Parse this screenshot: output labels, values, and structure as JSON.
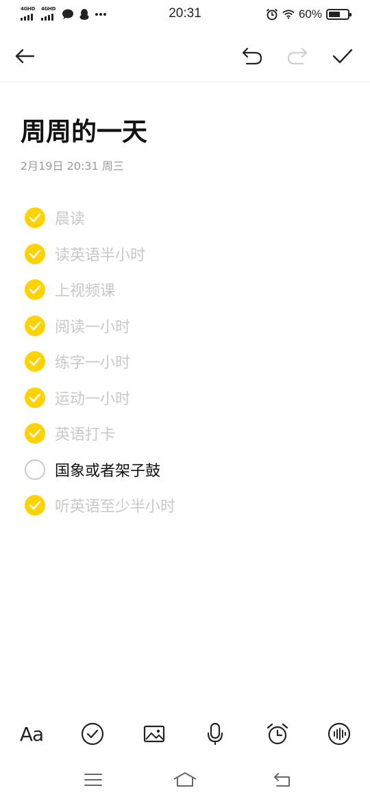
{
  "status_bar": {
    "net1": "4GHD",
    "net2": "4GHD",
    "time": "20:31",
    "battery_text": "60%",
    "battery_level": 0.6,
    "icons": [
      "signal-icon",
      "signal-icon",
      "chat-bubble-icon",
      "penguin-icon",
      "more-dots-icon",
      "alarm-icon",
      "wifi-icon",
      "battery-icon"
    ]
  },
  "toolbar": {
    "icons": [
      "back-arrow-icon",
      "undo-icon",
      "redo-icon",
      "done-check-icon"
    ]
  },
  "note": {
    "title": "周周的一天",
    "meta": "2月19日 20:31 周三"
  },
  "checklist": [
    {
      "label": "晨读",
      "done": true
    },
    {
      "label": "读英语半小时",
      "done": true
    },
    {
      "label": "上视频课",
      "done": true
    },
    {
      "label": "阅读一小时",
      "done": true
    },
    {
      "label": "练字一小时",
      "done": true
    },
    {
      "label": "运动一小时",
      "done": true
    },
    {
      "label": "英语打卡",
      "done": true
    },
    {
      "label": "国象或者架子鼓",
      "done": false
    },
    {
      "label": "听英语至少半小时",
      "done": true
    }
  ],
  "format_bar": {
    "text_format_label": "Aa",
    "icons": [
      "checklist-icon",
      "image-icon",
      "microphone-icon",
      "alarm-clock-icon",
      "voice-wave-icon"
    ]
  },
  "nav_bar": {
    "icons": [
      "menu-icon",
      "home-icon",
      "back-nav-icon"
    ]
  },
  "colors": {
    "accent": "#ffd200",
    "done_text": "#c8c8c8",
    "meta_text": "#9a9a9a"
  }
}
